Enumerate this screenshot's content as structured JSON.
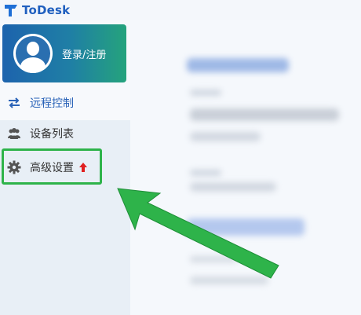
{
  "app": {
    "title": "ToDesk"
  },
  "account": {
    "login_label": "登录/注册"
  },
  "nav": {
    "remote_control": "远程控制",
    "device_list": "设备列表",
    "advanced_settings": "高级设置"
  },
  "colors": {
    "brand": "#1f5fbf",
    "login_gradient_start": "#1d63ad",
    "login_gradient_end": "#25a37c",
    "annotation_green": "#2eb34a",
    "badge_red": "#e02020"
  },
  "icons": {
    "logo": "todesk-logo-icon",
    "avatar": "user-avatar-icon",
    "remote": "swap-arrows-icon",
    "devices": "people-icon",
    "settings": "gear-icon",
    "badge": "red-up-arrow-icon"
  }
}
